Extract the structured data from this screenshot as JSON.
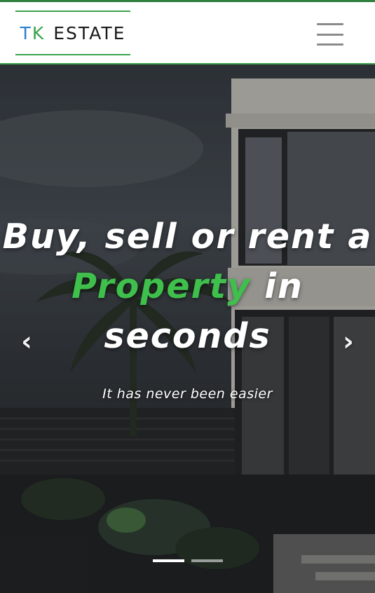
{
  "header": {
    "brand": {
      "letter_t": "T",
      "letter_k": "K",
      "rest": "ESTATE"
    },
    "menu_icon": "hamburger-menu-icon"
  },
  "colors": {
    "brand_t": "#2a7fd1",
    "brand_k": "#3aa34a",
    "accent": "#3fbf4c",
    "header_border": "#3aa34a"
  },
  "hero": {
    "headline_line1": "Buy, sell or rent a",
    "headline_accent": "Property",
    "headline_after_accent": " in",
    "headline_line3": "seconds",
    "subline": "It has never been easier",
    "prev_arrow": "‹",
    "next_arrow": "›",
    "prev_icon": "chevron-left-icon",
    "next_icon": "chevron-right-icon",
    "slides": [
      {
        "active": true
      },
      {
        "active": false
      }
    ]
  }
}
